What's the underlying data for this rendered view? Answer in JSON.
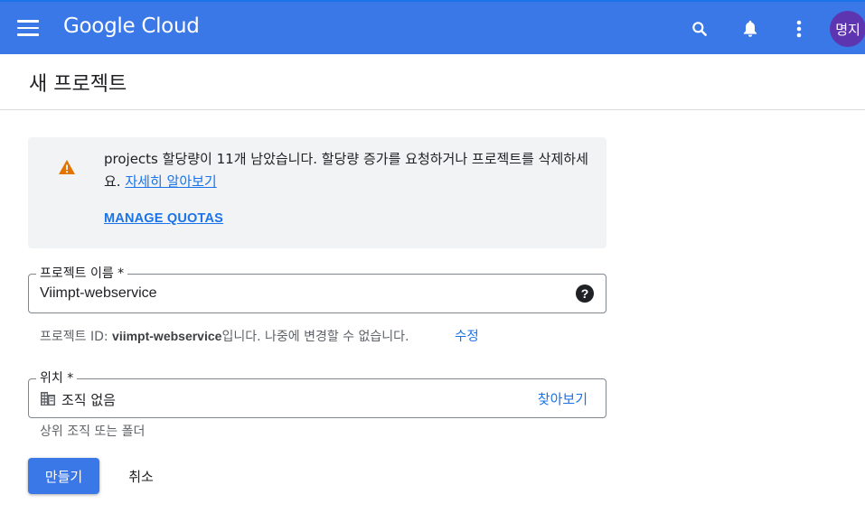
{
  "header": {
    "logo_text": "Google Cloud",
    "avatar_text": "명지",
    "accent_color": "#3b78e7"
  },
  "page": {
    "title": "새 프로젝트"
  },
  "notice": {
    "message": "projects 할당량이 11개 남았습니다. 할당량 증가를 요청하거나 프로젝트를 삭제하세요.",
    "learn_more": "자세히 알아보기",
    "manage_quotas": "MANAGE QUOTAS"
  },
  "project_name": {
    "label": "프로젝트 이름 *",
    "value": "Viimpt-webservice",
    "help": "?"
  },
  "project_id": {
    "prefix": "프로젝트 ID: ",
    "id": "viimpt-webservice",
    "suffix": "입니다. 나중에 변경할 수 없습니다.",
    "edit": "수정"
  },
  "location": {
    "label": "위치 *",
    "value": "조직 없음",
    "browse": "찾아보기",
    "hint": "상위 조직 또는 폴더"
  },
  "actions": {
    "create": "만들기",
    "cancel": "취소"
  }
}
